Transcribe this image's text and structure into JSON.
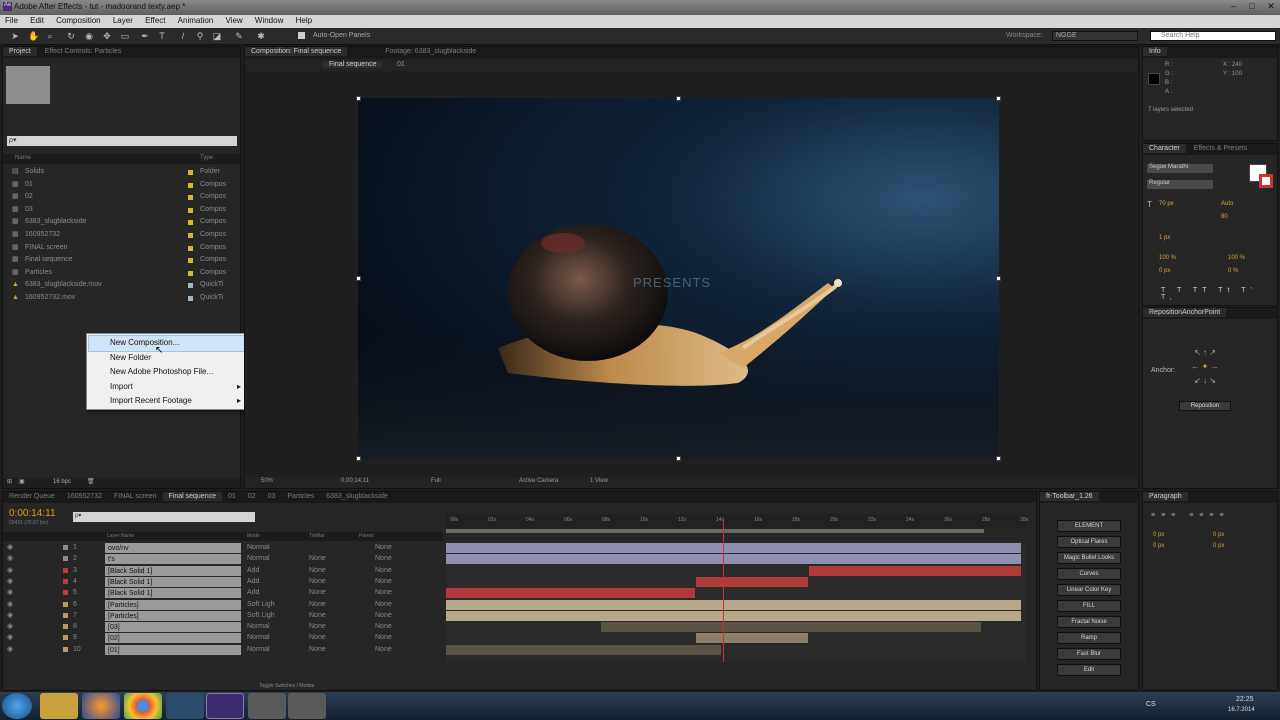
{
  "window": {
    "title": "Adobe After Effects - tut - madoorand texty.aep *"
  },
  "menu": [
    "File",
    "Edit",
    "Composition",
    "Layer",
    "Effect",
    "Animation",
    "View",
    "Window",
    "Help"
  ],
  "toolbar": {
    "auto_open": "Auto-Open Panels",
    "workspace_label": "Workspace:",
    "workspace_value": "NGGE",
    "search_placeholder": "Search Help"
  },
  "project": {
    "tabs": [
      "Project",
      "Effect Controls: Particles"
    ],
    "search_placeholder": "ρ▾",
    "col_name": "Name",
    "col_type": "Type",
    "items": [
      {
        "name": "Solids",
        "type": "Folder",
        "color": "#d8b42a"
      },
      {
        "name": "01",
        "type": "Compos",
        "color": "#d8b42a"
      },
      {
        "name": "02",
        "type": "Compos",
        "color": "#d8b42a"
      },
      {
        "name": "03",
        "type": "Compos",
        "color": "#d8b42a"
      },
      {
        "name": "6383_slugblackside",
        "type": "Compos",
        "color": "#d8b42a"
      },
      {
        "name": "160952732",
        "type": "Compos",
        "color": "#d8b42a"
      },
      {
        "name": "FINAL screen",
        "type": "Compos",
        "color": "#d8b42a"
      },
      {
        "name": "Final sequence",
        "type": "Compos",
        "color": "#d8b42a"
      },
      {
        "name": "Particles",
        "type": "Compos",
        "color": "#d8b42a"
      },
      {
        "name": "6383_slugblackside.mov",
        "type": "QuickTi",
        "color": "#9fb6c8"
      },
      {
        "name": "160952732.mov",
        "type": "QuickTi",
        "color": "#9fb6c8"
      }
    ],
    "bpc": "16 bpc"
  },
  "context_menu": {
    "items": [
      {
        "label": "New Composition...",
        "highlight": true,
        "submenu": false
      },
      {
        "label": "New Folder",
        "highlight": false,
        "submenu": false
      },
      {
        "label": "New Adobe Photoshop File...",
        "highlight": false,
        "submenu": false
      },
      {
        "label": "Import",
        "highlight": false,
        "submenu": true
      },
      {
        "label": "Import Recent Footage",
        "highlight": false,
        "submenu": true
      }
    ]
  },
  "composition": {
    "tab": "Composition: Final sequence",
    "footage_tab": "Footage: 6383_slugblackside",
    "breadcrumb": [
      "Final sequence",
      "01"
    ],
    "overlay_text": "PRESENTS",
    "zoom": "50%",
    "timecode": "0;00;14;11",
    "resolution": "Full",
    "camera": "Active Camera",
    "views": "1 View"
  },
  "info": {
    "tab": "Info",
    "r": "R :",
    "g": "G :",
    "b": "B :",
    "a": "A :",
    "x": "X : 240",
    "y": "Y : 100",
    "selected": "7 layers selected"
  },
  "character": {
    "tabs": [
      "Character",
      "Effects & Presets"
    ],
    "font": "Segoe Marathi",
    "style": "Regular",
    "size": "70 px",
    "leading": "Auto",
    "tracking": "80",
    "stroke": "1 px",
    "scale_v": "100 %",
    "scale_h": "100 %",
    "baseline": "0 px",
    "tsume": "0 %"
  },
  "reposition": {
    "tab": "RepositionAnchorPoint",
    "anchor_label": "Anchor:",
    "button": "Reposition"
  },
  "timeline": {
    "tabs": [
      "Render Queue",
      "160952732",
      "FINAL screen",
      "Final sequence",
      "01",
      "02",
      "03",
      "Particles",
      "6383_slugblackside"
    ],
    "timecode": "0:00:14:11",
    "fps": "00431 (29.97 fps)",
    "search_placeholder": "ρ▾",
    "col_layer": "Layer Name",
    "col_mode": "Mode",
    "col_trkmat": "TrkMat",
    "col_parent": "Parent",
    "ruler": [
      "00s",
      "02s",
      "04s",
      "06s",
      "08s",
      "10s",
      "12s",
      "14s",
      "16s",
      "18s",
      "20s",
      "22s",
      "24s",
      "26s",
      "28s",
      "30s"
    ],
    "layers": [
      {
        "n": "1",
        "name": "ovo/nv",
        "mode": "Normal",
        "trk": "",
        "parent": "None",
        "color": "#8a8a8a"
      },
      {
        "n": "2",
        "name": "t's",
        "mode": "Normal",
        "trk": "None",
        "parent": "None",
        "color": "#8a8a8a"
      },
      {
        "n": "3",
        "name": "[Black Solid 1]",
        "mode": "Add",
        "trk": "None",
        "parent": "None",
        "color": "#c03a3a"
      },
      {
        "n": "4",
        "name": "[Black Solid 1]",
        "mode": "Add",
        "trk": "None",
        "parent": "None",
        "color": "#c03a3a"
      },
      {
        "n": "5",
        "name": "[Black Solid 1]",
        "mode": "Add",
        "trk": "None",
        "parent": "None",
        "color": "#c03a3a"
      },
      {
        "n": "6",
        "name": "[Particles]",
        "mode": "Soft Ligh",
        "trk": "None",
        "parent": "None",
        "color": "#b99a5f"
      },
      {
        "n": "7",
        "name": "[Particles]",
        "mode": "Soft Ligh",
        "trk": "None",
        "parent": "None",
        "color": "#b99a5f"
      },
      {
        "n": "8",
        "name": "[03]",
        "mode": "Normal",
        "trk": "None",
        "parent": "None",
        "color": "#b99a5f"
      },
      {
        "n": "9",
        "name": "[02]",
        "mode": "Normal",
        "trk": "None",
        "parent": "None",
        "color": "#b99a5f"
      },
      {
        "n": "10",
        "name": "[01]",
        "mode": "Normal",
        "trk": "None",
        "parent": "None",
        "color": "#b99a5f"
      }
    ],
    "footer": "Toggle Switches / Modes"
  },
  "ft_toolbar": {
    "tab": "ft-Toolbar_1.26",
    "buttons": [
      "ELEMENT",
      "Optical Flares",
      "Magic Bullet Looks",
      "Curves",
      "Linear Color Key",
      "FILL",
      "Fractal Noise",
      "Ramp",
      "Fast Blur",
      "Edit"
    ]
  },
  "paragraph": {
    "tab": "Paragraph",
    "v1": "0 px",
    "v2": "0 px",
    "v3": "0 px",
    "v4": "0 px",
    "v5": "0 px"
  },
  "taskbar": {
    "lang": "CS",
    "time": "22:25",
    "date": "16.7.2014"
  }
}
